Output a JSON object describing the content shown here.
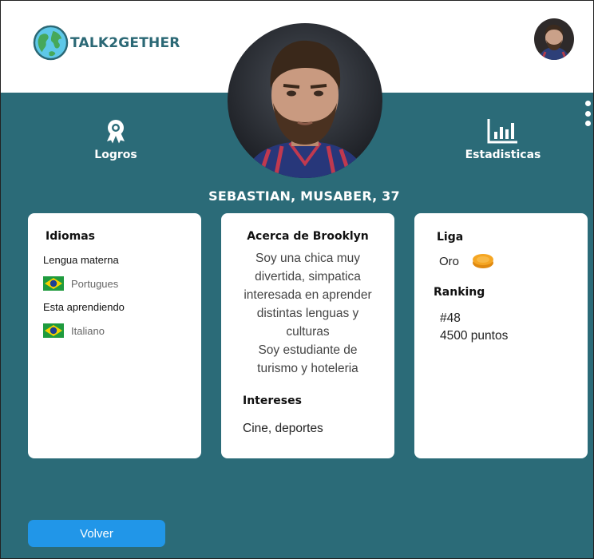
{
  "app": {
    "logo_text": "TALK2GETHER"
  },
  "nav": {
    "achievements_label": "Logros",
    "stats_label": "Estadisticas"
  },
  "profile": {
    "name_line": "SEBASTIAN, MUSABER, 37"
  },
  "languages_card": {
    "title": "Idiomas",
    "native_heading": "Lengua materna",
    "native_language": "Portugues",
    "learning_heading": "Esta aprendiendo",
    "learning_language": "Italiano"
  },
  "about_card": {
    "title": "Acerca de Brooklyn",
    "lines": [
      "Soy una chica muy",
      "divertida, simpatica",
      "interesada en aprender",
      "distintas lenguas y",
      "culturas",
      "Soy estudiante de",
      "turismo y hoteleria"
    ],
    "interests_title": "Intereses",
    "interests_text": "Cine, deportes"
  },
  "league_card": {
    "league_title": "Liga",
    "league_value": "Oro",
    "ranking_title": "Ranking",
    "rank_position": "#48",
    "points": "4500 puntos"
  },
  "actions": {
    "back_label": "Volver"
  },
  "colors": {
    "teal": "#2b6b78",
    "button_blue": "#2196e8",
    "coin_gold": "#f5a623"
  },
  "icons": [
    "globe-icon",
    "award-ribbon-icon",
    "bar-chart-icon",
    "more-vertical-icon",
    "brazil-flag-icon",
    "gold-coin-icon"
  ]
}
